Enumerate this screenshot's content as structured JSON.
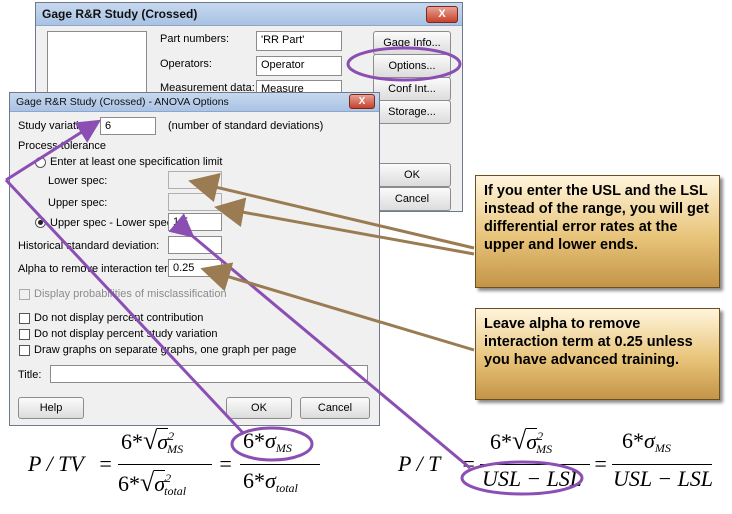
{
  "back_window": {
    "title": "Gage R&R Study (Crossed)",
    "close_label": "X",
    "labels": {
      "part_numbers": "Part numbers:",
      "operators": "Operators:",
      "measurement_data": "Measurement data:"
    },
    "values": {
      "part_numbers": "'RR Part'",
      "operators": "Operator",
      "measurement_data": "Measure"
    },
    "buttons": {
      "gage_info": "Gage Info...",
      "options": "Options...",
      "conf_int": "Conf Int...",
      "storage": "Storage...",
      "ok": "OK",
      "cancel": "Cancel"
    }
  },
  "options_dialog": {
    "title": "Gage R&R Study (Crossed) - ANOVA Options",
    "close_label": "X",
    "study_variation": {
      "label": "Study variation:",
      "value": "6",
      "note": "(number of standard deviations)"
    },
    "process_tolerance": {
      "group_label": "Process tolerance",
      "option_enter_spec": "Enter at least one specification limit",
      "lower_spec": "Lower spec:",
      "upper_spec": "Upper spec:",
      "option_upper_minus_lower": "Upper spec - Lower spec:",
      "upper_minus_lower_value": "1.5"
    },
    "historical_sd": {
      "label": "Historical standard deviation:"
    },
    "alpha": {
      "label": "Alpha to remove interaction term:",
      "value": "0.25"
    },
    "checkboxes": {
      "display_probabilities": "Display probabilities of misclassification",
      "no_percent_contribution": "Do not display percent contribution",
      "no_percent_study_variation": "Do not display percent study variation",
      "separate_graphs": "Draw graphs on separate graphs, one graph per page"
    },
    "title_field": {
      "label": "Title:"
    },
    "buttons": {
      "help": "Help",
      "ok": "OK",
      "cancel": "Cancel"
    }
  },
  "callouts": {
    "usl_lsl": "If you enter the USL and the LSL instead of the range, you will get differential error rates at the upper and lower ends.",
    "alpha": "Leave alpha to remove interaction term at 0.25 unless you have advanced training."
  },
  "formulas": {
    "ptv": {
      "lhs": "P / TV",
      "coef": "6*",
      "sigma": "σ",
      "sup2": "2",
      "ms": "MS",
      "total": "total"
    },
    "pt": {
      "lhs": "P / T",
      "coef": "6*",
      "sigma": "σ",
      "sup2": "2",
      "ms": "MS",
      "usl_lsl": "USL − LSL"
    },
    "eq": "="
  },
  "colors": {
    "highlight_purple": "#8b4fb4",
    "arrow_brown": "#9a7b52",
    "callout_border": "#6b4f1e"
  }
}
